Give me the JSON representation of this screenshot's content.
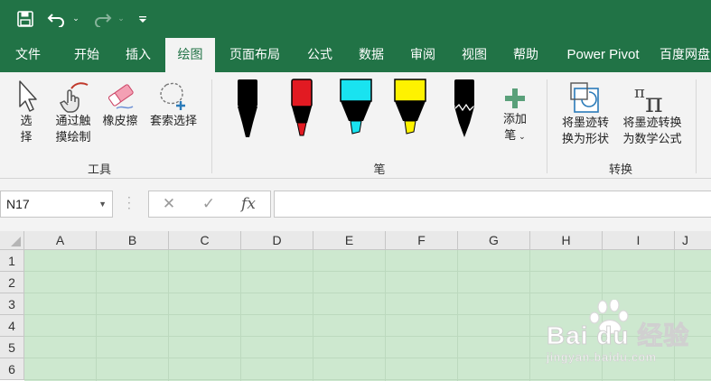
{
  "qat": {
    "save": "save-icon",
    "undo": "undo-icon",
    "redo": "redo-icon",
    "customize": "customize-qat-icon"
  },
  "tabs": [
    "文件",
    "开始",
    "插入",
    "绘图",
    "页面布局",
    "公式",
    "数据",
    "审阅",
    "视图",
    "帮助",
    "Power Pivot",
    "百度网盘"
  ],
  "active_tab": "绘图",
  "ribbon": {
    "tools": {
      "select_l1": "选",
      "select_l2": "择",
      "touch_l1": "通过触",
      "touch_l2": "摸绘制",
      "eraser": "橡皮擦",
      "lasso": "套索选择",
      "group_label": "工具"
    },
    "pens": {
      "group_label": "笔",
      "colors": [
        "#000000",
        "#e21a22",
        "#19e3f0",
        "#fef200",
        "#000000"
      ],
      "add_l1": "添加",
      "add_l2": "笔"
    },
    "convert": {
      "to_shape_l1": "将墨迹转",
      "to_shape_l2": "换为形状",
      "to_math_l1": "将墨迹转换",
      "to_math_l2": "为数学公式",
      "group_label": "转换"
    }
  },
  "formula_bar": {
    "name_box": "N17",
    "cancel": "✕",
    "enter": "✓",
    "fx": "fx",
    "formula": ""
  },
  "grid": {
    "columns": [
      "A",
      "B",
      "C",
      "D",
      "E",
      "F",
      "G",
      "H",
      "I",
      "J"
    ],
    "rows": [
      "1",
      "2",
      "3",
      "4",
      "5",
      "6"
    ]
  },
  "watermark": {
    "brand": "Bai du 经验",
    "url": "jingyan.baidu.com"
  }
}
